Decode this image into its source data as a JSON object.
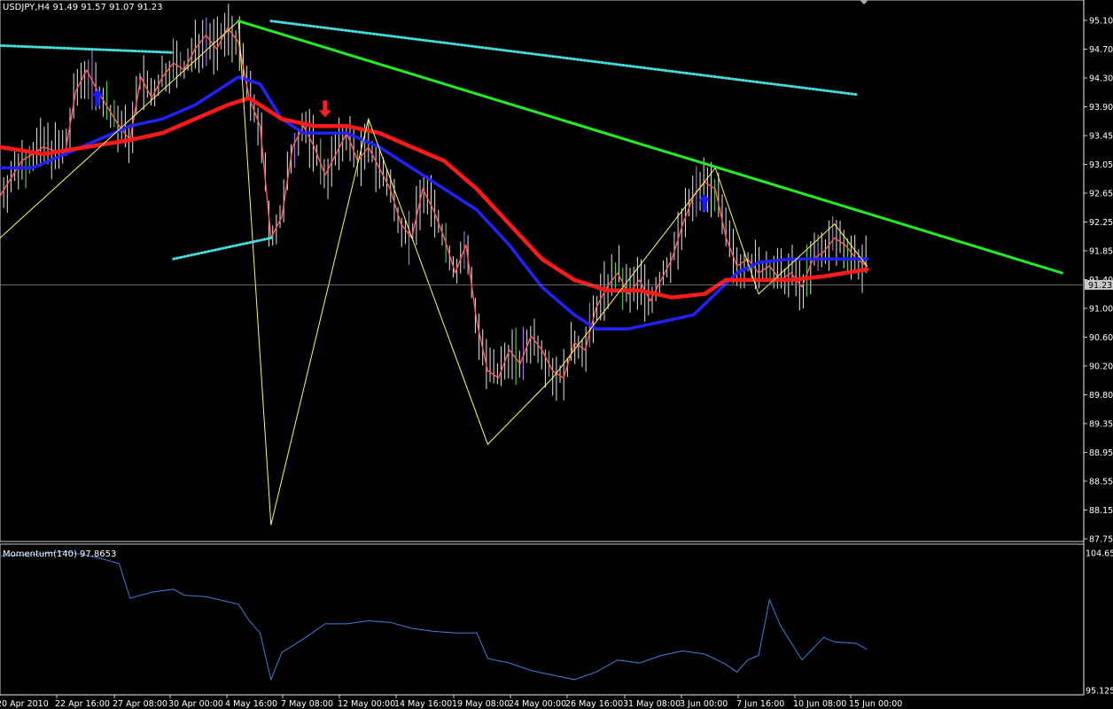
{
  "header": {
    "symbol": "USDJPY,H4",
    "ohlc": "91.49 91.57 91.07 91.23"
  },
  "chart_data": [
    {
      "type": "line",
      "title": "USDJPY,H4  91.49 91.57 91.07 91.23",
      "ylim": [
        87.6,
        95.25
      ],
      "y_tick_labels": [
        "95.10",
        "94.70",
        "94.30",
        "93.90",
        "93.45",
        "93.05",
        "92.65",
        "92.25",
        "91.85",
        "91.40",
        "91.00",
        "90.60",
        "90.20",
        "89.80",
        "89.35",
        "88.95",
        "88.55",
        "88.15",
        "87.75"
      ],
      "current_price_label": "91.23",
      "current_price": 91.23,
      "x_tick_labels": [
        "20 Apr 2010",
        "22 Apr 16:00",
        "27 Apr 08:00",
        "30 Apr 00:00",
        "4 May 16:00",
        "7 May 08:00",
        "12 May 00:00",
        "14 May 16:00",
        "19 May 08:00",
        "24 May 00:00",
        "26 May 16:00",
        "31 May 08:00",
        "3 Jun 00:00",
        "7 Jun 16:00",
        "10 Jun 08:00",
        "15 Jun 00:00"
      ],
      "x_range": [
        0,
        100
      ],
      "series": [
        {
          "color": "#ff5a5a",
          "points": [
            [
              0,
              92.5
            ],
            [
              2,
              93.0
            ],
            [
              4,
              93.2
            ],
            [
              6,
              93.1
            ],
            [
              7,
              94.0
            ],
            [
              8,
              94.3
            ],
            [
              9,
              94.0
            ],
            [
              11,
              93.5
            ],
            [
              12,
              93.3
            ],
            [
              13,
              94.2
            ],
            [
              14,
              93.9
            ],
            [
              15,
              94.2
            ],
            [
              16,
              94.4
            ],
            [
              17,
              94.3
            ],
            [
              18,
              94.6
            ],
            [
              19,
              94.8
            ],
            [
              20,
              94.6
            ],
            [
              21,
              94.9
            ],
            [
              22,
              94.7
            ],
            [
              23,
              93.9
            ],
            [
              24,
              93.5
            ],
            [
              25,
              91.9
            ],
            [
              26,
              92.2
            ],
            [
              27,
              93.2
            ],
            [
              28,
              93.5
            ],
            [
              29,
              93.2
            ],
            [
              30,
              92.8
            ],
            [
              31,
              93.1
            ],
            [
              32,
              93.4
            ],
            [
              33,
              93.0
            ],
            [
              34,
              93.2
            ],
            [
              35,
              92.9
            ],
            [
              36,
              92.6
            ],
            [
              37,
              92.1
            ],
            [
              38,
              91.9
            ],
            [
              39,
              92.6
            ],
            [
              40,
              92.3
            ],
            [
              41,
              91.9
            ],
            [
              42,
              91.4
            ],
            [
              43,
              91.8
            ],
            [
              44,
              90.7
            ],
            [
              45,
              90.0
            ],
            [
              46,
              89.9
            ],
            [
              47,
              90.3
            ],
            [
              48,
              90.1
            ],
            [
              49,
              90.5
            ],
            [
              50,
              90.3
            ],
            [
              51,
              90.0
            ],
            [
              52,
              89.9
            ],
            [
              53,
              90.4
            ],
            [
              54,
              90.3
            ],
            [
              55,
              90.9
            ],
            [
              56,
              91.2
            ],
            [
              57,
              91.4
            ],
            [
              58,
              91.1
            ],
            [
              59,
              91.3
            ],
            [
              60,
              91.0
            ],
            [
              61,
              91.3
            ],
            [
              62,
              91.6
            ],
            [
              63,
              92.1
            ],
            [
              64,
              92.5
            ],
            [
              65,
              92.7
            ],
            [
              66,
              92.6
            ],
            [
              67,
              91.9
            ],
            [
              68,
              91.5
            ],
            [
              69,
              91.6
            ],
            [
              70,
              91.4
            ],
            [
              71,
              91.5
            ],
            [
              72,
              91.3
            ],
            [
              73,
              91.4
            ],
            [
              74,
              91.2
            ],
            [
              75,
              91.6
            ],
            [
              76,
              91.7
            ],
            [
              77,
              91.9
            ],
            [
              78,
              91.8
            ],
            [
              79,
              91.6
            ],
            [
              80,
              91.5
            ]
          ]
        },
        {
          "color": "#2222ff",
          "points": [
            [
              0,
              92.9
            ],
            [
              3,
              92.9
            ],
            [
              6,
              93.1
            ],
            [
              9,
              93.3
            ],
            [
              12,
              93.5
            ],
            [
              15,
              93.6
            ],
            [
              18,
              93.8
            ],
            [
              20,
              94.0
            ],
            [
              22,
              94.2
            ],
            [
              24,
              94.1
            ],
            [
              26,
              93.6
            ],
            [
              28,
              93.4
            ],
            [
              30,
              93.4
            ],
            [
              32,
              93.4
            ],
            [
              35,
              93.2
            ],
            [
              38,
              92.9
            ],
            [
              41,
              92.6
            ],
            [
              44,
              92.3
            ],
            [
              47,
              91.8
            ],
            [
              50,
              91.2
            ],
            [
              53,
              90.8
            ],
            [
              55,
              90.6
            ],
            [
              58,
              90.6
            ],
            [
              61,
              90.7
            ],
            [
              64,
              90.8
            ],
            [
              66,
              91.1
            ],
            [
              68,
              91.4
            ],
            [
              70,
              91.55
            ],
            [
              73,
              91.6
            ],
            [
              76,
              91.6
            ],
            [
              80,
              91.6
            ]
          ]
        },
        {
          "color": "#ff1a1a",
          "points": [
            [
              0,
              93.2
            ],
            [
              4,
              93.1
            ],
            [
              8,
              93.2
            ],
            [
              12,
              93.3
            ],
            [
              15,
              93.4
            ],
            [
              18,
              93.6
            ],
            [
              21,
              93.8
            ],
            [
              23,
              93.9
            ],
            [
              26,
              93.6
            ],
            [
              29,
              93.5
            ],
            [
              32,
              93.5
            ],
            [
              35,
              93.4
            ],
            [
              38,
              93.2
            ],
            [
              41,
              93.0
            ],
            [
              44,
              92.6
            ],
            [
              47,
              92.1
            ],
            [
              50,
              91.6
            ],
            [
              53,
              91.3
            ],
            [
              56,
              91.15
            ],
            [
              59,
              91.15
            ],
            [
              62,
              91.05
            ],
            [
              65,
              91.1
            ],
            [
              67,
              91.3
            ],
            [
              70,
              91.3
            ],
            [
              73,
              91.3
            ],
            [
              76,
              91.35
            ],
            [
              80,
              91.45
            ]
          ]
        },
        {
          "color": "#ffff55",
          "points": [
            [
              0,
              91.9
            ],
            [
              22,
              95.0
            ],
            [
              25,
              87.8
            ],
            [
              34,
              93.6
            ],
            [
              45,
              88.95
            ],
            [
              51,
              89.9
            ],
            [
              66,
              92.9
            ],
            [
              70,
              91.1
            ],
            [
              77,
              92.1
            ],
            [
              80,
              91.5
            ]
          ]
        },
        {
          "color": "#22ee22",
          "points": [
            [
              22,
              95.0
            ],
            [
              98,
              91.4
            ]
          ]
        },
        {
          "color": "#44dddd",
          "points": [
            [
              0,
              94.65
            ],
            [
              16,
              94.55
            ]
          ]
        },
        {
          "color": "#44dddd",
          "points": [
            [
              25,
              95.0
            ],
            [
              79,
              93.95
            ]
          ]
        },
        {
          "color": "#44dddd",
          "points": [
            [
              16,
              91.6
            ],
            [
              25,
              91.9
            ]
          ]
        }
      ],
      "arrows": [
        {
          "direction": "up",
          "color": "#1a1aff",
          "x": 9,
          "y": 93.9
        },
        {
          "direction": "down",
          "color": "#ff2020",
          "x": 30,
          "y": 93.75
        },
        {
          "direction": "up",
          "color": "#1a1aff",
          "x": 65,
          "y": 92.4
        }
      ]
    },
    {
      "type": "line",
      "title": "Momentum(140) 97.8653",
      "ylim": [
        95.1253,
        104.654
      ],
      "y_tick_labels": [
        "104.654",
        "95.1253"
      ],
      "series": [
        {
          "color": "#3a80e0",
          "points": [
            [
              0,
              104.1
            ],
            [
              3,
              104.2
            ],
            [
              6,
              104.4
            ],
            [
              9,
              104.0
            ],
            [
              11,
              103.6
            ],
            [
              12,
              101.3
            ],
            [
              14,
              101.7
            ],
            [
              16,
              101.9
            ],
            [
              17,
              101.5
            ],
            [
              19,
              101.4
            ],
            [
              22,
              100.9
            ],
            [
              23,
              99.8
            ],
            [
              24,
              99.0
            ],
            [
              25,
              95.9
            ],
            [
              26,
              97.7
            ],
            [
              28,
              98.6
            ],
            [
              30,
              99.6
            ],
            [
              32,
              99.6
            ],
            [
              34,
              99.8
            ],
            [
              36,
              99.7
            ],
            [
              38,
              99.3
            ],
            [
              40,
              99.1
            ],
            [
              42,
              99.0
            ],
            [
              44,
              99.0
            ],
            [
              45,
              97.3
            ],
            [
              47,
              97.0
            ],
            [
              49,
              96.5
            ],
            [
              51,
              96.2
            ],
            [
              53,
              95.9
            ],
            [
              55,
              96.4
            ],
            [
              57,
              97.2
            ],
            [
              59,
              97.0
            ],
            [
              61,
              97.5
            ],
            [
              63,
              97.8
            ],
            [
              65,
              97.6
            ],
            [
              67,
              96.9
            ],
            [
              68,
              96.4
            ],
            [
              69,
              97.2
            ],
            [
              70,
              97.5
            ],
            [
              71,
              101.2
            ],
            [
              72,
              99.5
            ],
            [
              74,
              97.2
            ],
            [
              76,
              98.7
            ],
            [
              77,
              98.4
            ],
            [
              79,
              98.3
            ],
            [
              80,
              97.9
            ]
          ]
        }
      ]
    }
  ]
}
